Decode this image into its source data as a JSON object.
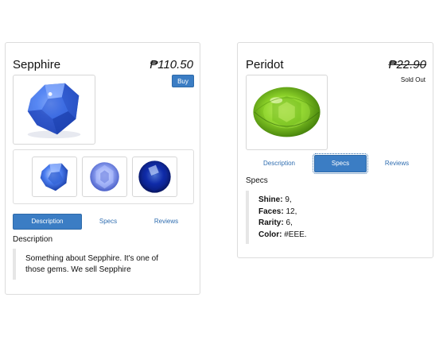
{
  "products": [
    {
      "name": "Sepphire",
      "price": "₱110.50",
      "buy_label": "Buy",
      "tabs": [
        "Description",
        "Specs",
        "Reviews"
      ],
      "active_tab": "Description",
      "section_title": "Description",
      "description": "Something about Sepphire. It's one of those gems. We sell Sepphire",
      "thumbnail_count": 3,
      "colors": {
        "gem": "#2f5fd8",
        "accent": "#3b7dc4"
      }
    },
    {
      "name": "Peridot",
      "price": "₱22.90",
      "price_strikethrough": true,
      "status": "Sold Out",
      "tabs": [
        "Description",
        "Specs",
        "Reviews"
      ],
      "active_tab": "Specs",
      "section_title": "Specs",
      "specs": [
        {
          "label": "Shine",
          "value": "9,"
        },
        {
          "label": "Faces",
          "value": "12,"
        },
        {
          "label": "Rarity",
          "value": "6,"
        },
        {
          "label": "Color",
          "value": "#EEE."
        }
      ],
      "colors": {
        "gem": "#7cc21e",
        "accent": "#3b7dc4"
      }
    }
  ]
}
